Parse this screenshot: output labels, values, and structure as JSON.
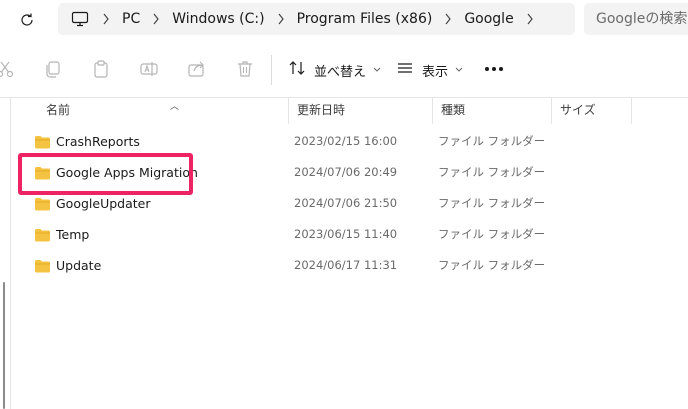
{
  "breadcrumb": {
    "items": [
      "PC",
      "Windows (C:)",
      "Program Files (x86)",
      "Google"
    ]
  },
  "search": {
    "placeholder": "Googleの検索"
  },
  "toolbar": {
    "sort_label": "並べ替え",
    "view_label": "表示"
  },
  "columns": {
    "name": "名前",
    "date": "更新日時",
    "type": "種類",
    "size": "サイズ"
  },
  "files": [
    {
      "name": "CrashReports",
      "date": "2023/02/15 16:00",
      "type": "ファイル フォルダー"
    },
    {
      "name": "Google Apps Migration",
      "date": "2024/07/06 20:49",
      "type": "ファイル フォルダー"
    },
    {
      "name": "GoogleUpdater",
      "date": "2024/07/06 21:50",
      "type": "ファイル フォルダー"
    },
    {
      "name": "Temp",
      "date": "2023/06/15 11:40",
      "type": "ファイル フォルダー"
    },
    {
      "name": "Update",
      "date": "2024/06/17 11:31",
      "type": "ファイル フォルダー"
    }
  ],
  "colors": {
    "highlight": "#ee2364",
    "folder": "#f5c342"
  },
  "icons": [
    "refresh-icon",
    "computer-icon",
    "chevron-right-icon",
    "cut-icon",
    "copy-icon",
    "paste-icon",
    "rename-icon",
    "share-icon",
    "delete-icon",
    "sort-icon",
    "view-icon",
    "more-icon",
    "folder-icon"
  ]
}
